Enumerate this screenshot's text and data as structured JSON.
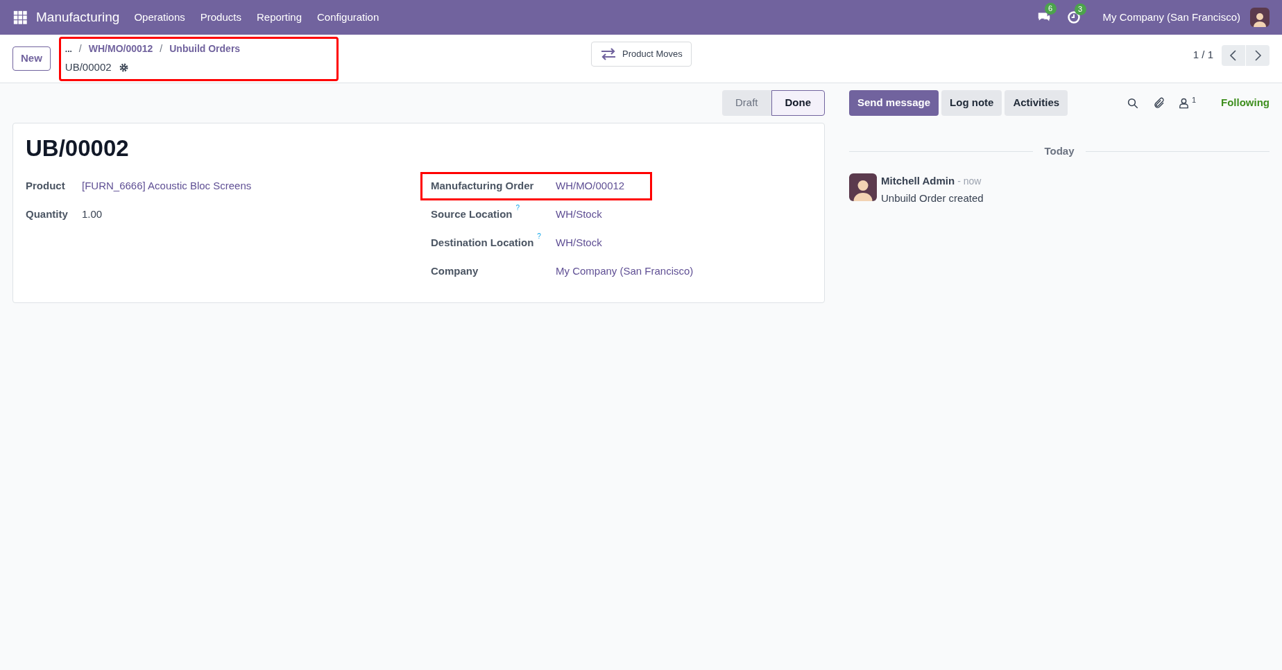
{
  "navbar": {
    "app_name": "Manufacturing",
    "menu": [
      "Operations",
      "Products",
      "Reporting",
      "Configuration"
    ],
    "messages_count": "6",
    "activities_count": "3",
    "company": "My Company (San Francisco)"
  },
  "control_panel": {
    "new_button": "New",
    "breadcrumb": {
      "ellipsis": "...",
      "separator": "/",
      "items": [
        "WH/MO/00012",
        "Unbuild Orders"
      ],
      "current": "UB/00002",
      "highlighted": true
    },
    "smart_button": "Product Moves",
    "pager": "1 / 1"
  },
  "statusbar": [
    {
      "label": "Draft",
      "selected": false
    },
    {
      "label": "Done",
      "selected": true
    }
  ],
  "form": {
    "title": "UB/00002",
    "left_fields": [
      {
        "label": "Product",
        "help": false,
        "value": "[FURN_6666] Acoustic Bloc Screens",
        "link": true,
        "highlighted": false
      },
      {
        "label": "Quantity",
        "help": false,
        "value": "1.00",
        "link": false,
        "highlighted": false
      }
    ],
    "right_fields": [
      {
        "label": "Manufacturing Order",
        "help": false,
        "value": "WH/MO/00012",
        "link": true,
        "highlighted": true
      },
      {
        "label": "Source Location",
        "help": "?",
        "value": "WH/Stock",
        "link": true,
        "highlighted": false
      },
      {
        "label": "Destination Location",
        "help": "?",
        "value": "WH/Stock",
        "link": true,
        "highlighted": false
      },
      {
        "label": "Company",
        "help": false,
        "value": "My Company (San Francisco)",
        "link": true,
        "highlighted": false
      }
    ]
  },
  "chatter": {
    "buttons": [
      {
        "label": "Send message",
        "selected": true
      },
      {
        "label": "Log note",
        "selected": false
      },
      {
        "label": "Activities",
        "selected": false
      }
    ],
    "followers_count": "1",
    "follow_status": "Following",
    "date_separator": "Today",
    "messages": [
      {
        "author": "Mitchell Admin",
        "time": "- now",
        "body": "Unbuild Order created"
      }
    ]
  }
}
